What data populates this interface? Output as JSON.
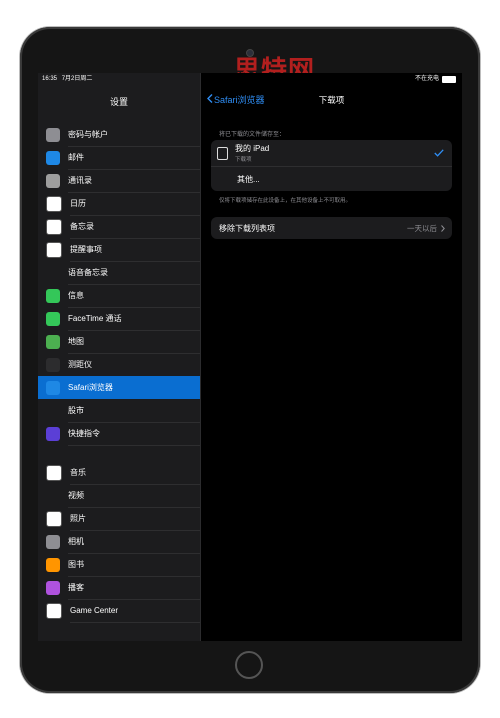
{
  "watermark": "思特网",
  "status": {
    "time": "16:35",
    "date": "7月2日周二",
    "charging": "不在充电"
  },
  "sidebar": {
    "title": "设置",
    "group1": [
      {
        "label": "密码与帐户",
        "icon": "key-icon",
        "color": "#8e8e93"
      },
      {
        "label": "邮件",
        "icon": "mail-icon",
        "color": "#1e88e5"
      },
      {
        "label": "通讯录",
        "icon": "contacts-icon",
        "color": "#9e9e9e"
      },
      {
        "label": "日历",
        "icon": "calendar-icon",
        "color": "#ffffff"
      },
      {
        "label": "备忘录",
        "icon": "notes-icon",
        "color": "#ffffff"
      },
      {
        "label": "提醒事项",
        "icon": "reminders-icon",
        "color": "#ffffff"
      },
      {
        "label": "语音备忘录",
        "icon": "voice-memos-icon",
        "color": "#1c1c1e"
      },
      {
        "label": "信息",
        "icon": "messages-icon",
        "color": "#34c759"
      },
      {
        "label": "FaceTime 通话",
        "icon": "facetime-icon",
        "color": "#34c759"
      },
      {
        "label": "地图",
        "icon": "maps-icon",
        "color": "#4caf50"
      },
      {
        "label": "测距仪",
        "icon": "measure-icon",
        "color": "#2c2c2e"
      },
      {
        "label": "Safari浏览器",
        "icon": "safari-icon",
        "color": "#1e88e5",
        "selected": true
      },
      {
        "label": "股市",
        "icon": "stocks-icon",
        "color": "#1c1c1e"
      },
      {
        "label": "快捷指令",
        "icon": "shortcuts-icon",
        "color": "#5b3fd6"
      }
    ],
    "group2": [
      {
        "label": "音乐",
        "icon": "music-icon",
        "color": "#ffffff"
      },
      {
        "label": "视频",
        "icon": "tv-icon",
        "color": "#1c1c1e"
      },
      {
        "label": "照片",
        "icon": "photos-icon",
        "color": "#ffffff"
      },
      {
        "label": "相机",
        "icon": "camera-icon",
        "color": "#8e8e93"
      },
      {
        "label": "图书",
        "icon": "books-icon",
        "color": "#ff9500"
      },
      {
        "label": "播客",
        "icon": "podcasts-icon",
        "color": "#af52de"
      },
      {
        "label": "Game Center",
        "icon": "game-center-icon",
        "color": "#ffffff"
      }
    ]
  },
  "detail": {
    "back_label": "Safari浏览器",
    "title": "下载项",
    "section_header": "将已下载的文件储存至：",
    "location_name": "我的 iPad",
    "location_sub": "下载项",
    "other_label": "其他...",
    "footnote": "仅将下载项储存在此设备上，在其他设备上不可取用。",
    "remove_label": "移除下载列表项",
    "remove_value": "一天以后"
  }
}
